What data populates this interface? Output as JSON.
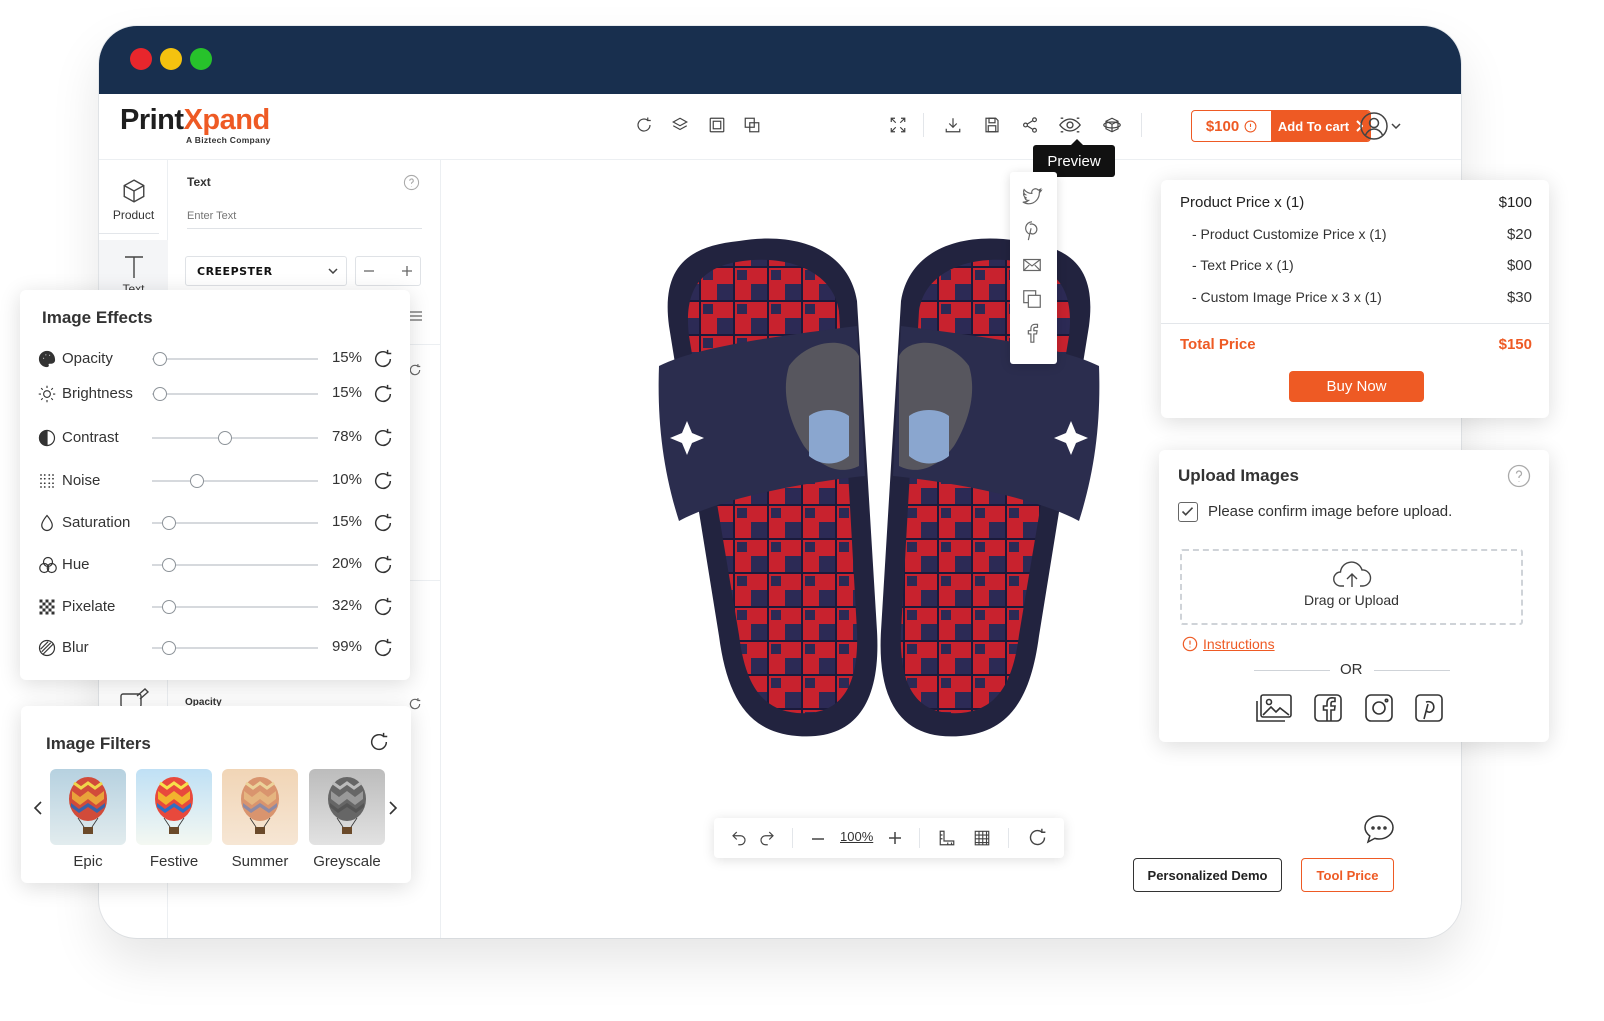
{
  "brand": {
    "name_part1": "Print",
    "name_part2": "X",
    "name_part3": "pand",
    "tagline": "A Biztech Company"
  },
  "colors": {
    "accent": "#ee5a24",
    "titlebar": "#182f4e"
  },
  "toolbar": {
    "left_icons": [
      "refresh-icon",
      "layers-icon",
      "layer-front-icon",
      "duplicate-icon"
    ],
    "right_icons": [
      "fullscreen-icon",
      "download-icon",
      "save-icon",
      "share-icon",
      "preview-icon",
      "3d-view-icon"
    ],
    "price": "$100",
    "add_to_cart": "Add To cart",
    "preview_tooltip": "Preview"
  },
  "sidenav": {
    "items": [
      {
        "label": "Product",
        "icon": "cube-icon"
      },
      {
        "label": "Text",
        "icon": "text-icon"
      }
    ]
  },
  "text_panel": {
    "label": "Text",
    "placeholder": "Enter Text",
    "font": "CREEPSTER",
    "opacity_label": "Opacity"
  },
  "share": {
    "icons": [
      "twitter-icon",
      "pinterest-icon",
      "mail-icon",
      "copy-icon",
      "facebook-icon"
    ]
  },
  "price_card": {
    "product_price": "Product Price  x  (1)",
    "product_price_value": "$100",
    "customize": "- Product Customize Price  x  (1)",
    "customize_value": "$20",
    "text": "- Text Price x (1)",
    "text_value": "$00",
    "custom_image": "- Custom Image Price x 3 x  (1)",
    "custom_image_value": "$30",
    "total_label": "Total Price",
    "total_value": "$150",
    "buy_now": "Buy Now"
  },
  "upload": {
    "title": "Upload Images",
    "confirm": "Please confirm image before upload.",
    "confirm_checked": true,
    "drop_label": "Drag or Upload",
    "instructions": "Instructions",
    "or": "OR",
    "sources": [
      "gallery-icon",
      "facebook-icon",
      "instagram-icon",
      "pinterest-icon"
    ]
  },
  "effects": {
    "title": "Image Effects",
    "items": [
      {
        "label": "Opacity",
        "value": "15%",
        "level": 0.05,
        "icon": "palette-icon"
      },
      {
        "label": "Brightness",
        "value": "15%",
        "level": 0.05,
        "icon": "sun-icon"
      },
      {
        "label": "Contrast",
        "value": "78%",
        "level": 0.44,
        "icon": "contrast-icon"
      },
      {
        "label": "Noise",
        "value": "10%",
        "level": 0.27,
        "icon": "noise-icon"
      },
      {
        "label": "Saturation",
        "value": "15%",
        "level": 0.1,
        "icon": "drop-icon"
      },
      {
        "label": "Hue",
        "value": "20%",
        "level": 0.1,
        "icon": "hue-circles-icon"
      },
      {
        "label": "Pixelate",
        "value": "32%",
        "level": 0.1,
        "icon": "pixelate-icon"
      },
      {
        "label": "Blur",
        "value": "99%",
        "level": 0.1,
        "icon": "blur-icon"
      }
    ]
  },
  "filters": {
    "title": "Image Filters",
    "items": [
      {
        "label": "Epic",
        "tone": "epic"
      },
      {
        "label": "Festive",
        "tone": "festive"
      },
      {
        "label": "Summer",
        "tone": "summer"
      },
      {
        "label": "Greyscale",
        "tone": "grey"
      }
    ]
  },
  "zoom": {
    "level": "100%"
  },
  "buttons": {
    "demo": "Personalized Demo",
    "tool_price": "Tool Price"
  }
}
